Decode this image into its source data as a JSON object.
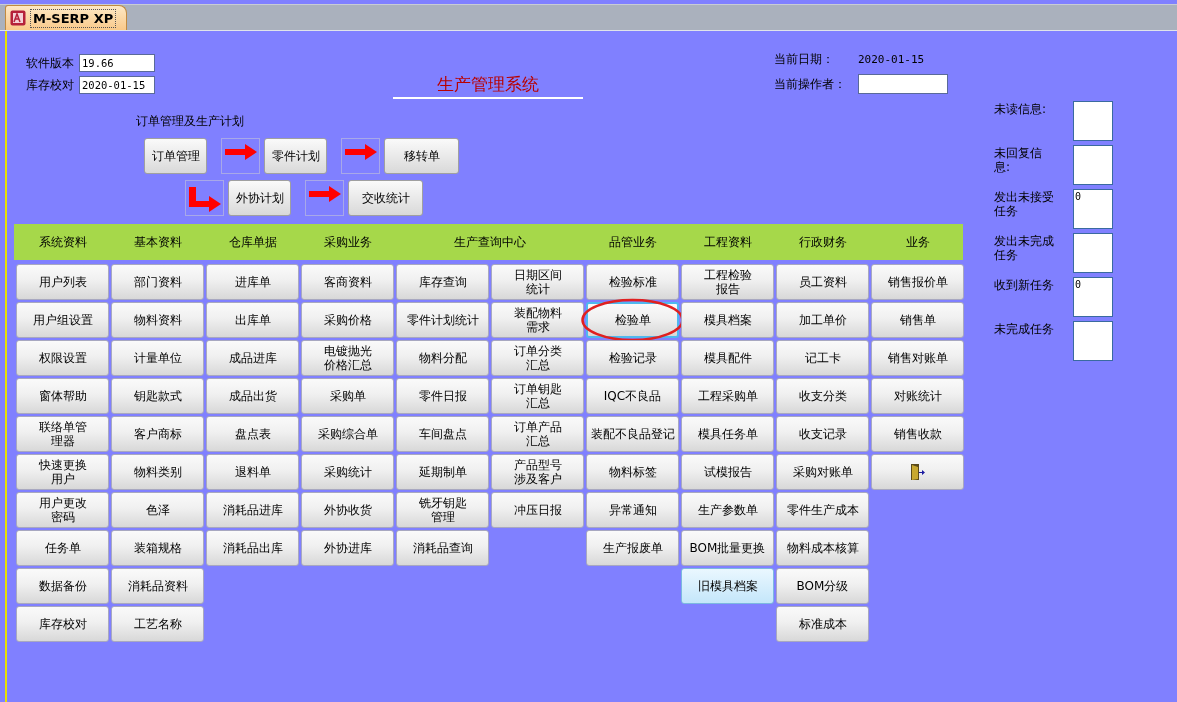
{
  "window": {
    "tab": "M-SERP XP"
  },
  "version": {
    "label": "软件版本",
    "value": "19.66"
  },
  "stock_check": {
    "label": "库存校对",
    "value": "2020-01-15"
  },
  "title": "生产管理系统",
  "current_date": {
    "label": "当前日期：",
    "value": "2020-01-15"
  },
  "operator": {
    "label": "当前操作者："
  },
  "order_plan": {
    "title": "订单管理及生产计划",
    "rows": [
      [
        {
          "kind": "button",
          "label": "订单管理"
        },
        {
          "kind": "arrow"
        },
        {
          "kind": "button",
          "label": "零件计划"
        },
        {
          "kind": "arrow"
        },
        {
          "kind": "button",
          "label": "移转单"
        }
      ],
      [
        {
          "kind": "spacer"
        },
        {
          "kind": "bend"
        },
        {
          "kind": "button",
          "label": "外协计划"
        },
        {
          "kind": "arrow"
        },
        {
          "kind": "button",
          "label": "交收统计"
        }
      ]
    ]
  },
  "menu": [
    {
      "header": "系统资料",
      "columns": [
        [
          {
            "label": "用户列表",
            "kind": "plain"
          },
          {
            "label": "用户组设置",
            "kind": "plain"
          },
          {
            "label": "权限设置",
            "kind": "plain"
          },
          {
            "label": "窗体帮助",
            "kind": "plain"
          },
          {
            "label": "联络单管理器",
            "kind": "wrapped"
          },
          {
            "label": "快速更换用户",
            "kind": "wrapped"
          },
          {
            "label": "用户更改密码",
            "kind": "wrapped"
          },
          {
            "label": "任务单",
            "kind": "plain"
          },
          {
            "label": "数据备份",
            "kind": "plain"
          },
          {
            "label": "库存校对",
            "kind": "plain"
          }
        ]
      ]
    },
    {
      "header": "基本资料",
      "columns": [
        [
          {
            "label": "部门资料",
            "kind": "plain"
          },
          {
            "label": "物料资料",
            "kind": "plain"
          },
          {
            "label": "计量单位",
            "kind": "plain"
          },
          {
            "label": "钥匙款式",
            "kind": "plain"
          },
          {
            "label": "客户商标",
            "kind": "plain"
          },
          {
            "label": "物料类别",
            "kind": "plain"
          },
          {
            "label": "色泽",
            "kind": "plain"
          },
          {
            "label": "装箱规格",
            "kind": "plain"
          },
          {
            "label": "消耗品资料",
            "kind": "plain"
          },
          {
            "label": "工艺名称",
            "kind": "plain"
          }
        ]
      ]
    },
    {
      "header": "仓库单据",
      "columns": [
        [
          {
            "label": "进库单",
            "kind": "plain"
          },
          {
            "label": "出库单",
            "kind": "plain"
          },
          {
            "label": "成品进库",
            "kind": "plain"
          },
          {
            "label": "成品出货",
            "kind": "plain"
          },
          {
            "label": "盘点表",
            "kind": "plain"
          },
          {
            "label": "退料单",
            "kind": "plain"
          },
          {
            "label": "消耗品进库",
            "kind": "plain"
          },
          {
            "label": "消耗品出库",
            "kind": "plain"
          }
        ]
      ]
    },
    {
      "header": "采购业务",
      "columns": [
        [
          {
            "label": "客商资料",
            "kind": "plain"
          },
          {
            "label": "采购价格",
            "kind": "plain"
          },
          {
            "label": "电镀抛光价格汇总",
            "kind": "wrapped"
          },
          {
            "label": "采购单",
            "kind": "plain"
          },
          {
            "label": "采购综合单",
            "kind": "plain"
          },
          {
            "label": "采购统计",
            "kind": "plain"
          },
          {
            "label": "外协收货",
            "kind": "plain"
          },
          {
            "label": "外协进库",
            "kind": "plain"
          }
        ]
      ]
    },
    {
      "header": "生产查询中心",
      "columns": [
        [
          {
            "label": "库存查询",
            "kind": "plain"
          },
          {
            "label": "零件计划统计",
            "kind": "plain"
          },
          {
            "label": "物料分配",
            "kind": "plain"
          },
          {
            "label": "零件日报",
            "kind": "plain"
          },
          {
            "label": "车间盘点",
            "kind": "plain"
          },
          {
            "label": "延期制单",
            "kind": "plain"
          },
          {
            "label": "铣牙钥匙管理",
            "kind": "wrapped"
          },
          {
            "label": "消耗品查询",
            "kind": "plain"
          }
        ],
        [
          {
            "label": "日期区间统计",
            "kind": "wrapped"
          },
          {
            "label": "装配物料需求",
            "kind": "wrapped"
          },
          {
            "label": "订单分类汇总",
            "kind": "wrapped"
          },
          {
            "label": "订单钥匙汇总",
            "kind": "wrapped"
          },
          {
            "label": "订单产品汇总",
            "kind": "wrapped"
          },
          {
            "label": "产品型号涉及客户",
            "kind": "wrapped"
          },
          {
            "label": "冲压日报",
            "kind": "plain"
          }
        ]
      ]
    },
    {
      "header": "品管业务",
      "columns": [
        [
          {
            "label": "检验标准",
            "kind": "plain"
          },
          {
            "label": "检验单",
            "kind": "circled"
          },
          {
            "label": "检验记录",
            "kind": "plain"
          },
          {
            "label": "IQC不良品",
            "kind": "plain"
          },
          {
            "label": "装配不良品登记",
            "kind": "plain"
          },
          {
            "label": "物料标签",
            "kind": "plain"
          },
          {
            "label": "异常通知",
            "kind": "plain"
          },
          {
            "label": "生产报废单",
            "kind": "plain"
          }
        ]
      ]
    },
    {
      "header": "工程资料",
      "columns": [
        [
          {
            "label": "工程检验报告",
            "kind": "wrapped"
          },
          {
            "label": "模具档案",
            "kind": "plain"
          },
          {
            "label": "模具配件",
            "kind": "plain"
          },
          {
            "label": "工程采购单",
            "kind": "plain"
          },
          {
            "label": "模具任务单",
            "kind": "plain"
          },
          {
            "label": "试模报告",
            "kind": "plain"
          },
          {
            "label": "生产参数单",
            "kind": "plain"
          },
          {
            "label": "BOM批量更换",
            "kind": "plain"
          },
          {
            "label": "旧模具档案",
            "kind": "hover"
          }
        ]
      ]
    },
    {
      "header": "行政财务",
      "columns": [
        [
          {
            "label": "员工资料",
            "kind": "plain"
          },
          {
            "label": "加工单价",
            "kind": "plain"
          },
          {
            "label": "记工卡",
            "kind": "plain"
          },
          {
            "label": "收支分类",
            "kind": "plain"
          },
          {
            "label": "收支记录",
            "kind": "plain"
          },
          {
            "label": "采购对账单",
            "kind": "plain"
          },
          {
            "label": "零件生产成本",
            "kind": "plain"
          },
          {
            "label": "物料成本核算",
            "kind": "plain"
          },
          {
            "label": "BOM分级",
            "kind": "plain"
          },
          {
            "label": "标准成本",
            "kind": "plain"
          }
        ]
      ]
    },
    {
      "header": "业务",
      "columns": [
        [
          {
            "label": "销售报价单",
            "kind": "plain"
          },
          {
            "label": "销售单",
            "kind": "plain"
          },
          {
            "label": "销售对账单",
            "kind": "plain"
          },
          {
            "label": "对账统计",
            "kind": "plain"
          },
          {
            "label": "销售收款",
            "kind": "plain"
          },
          {
            "kind": "exit"
          }
        ]
      ]
    }
  ],
  "messages": [
    {
      "label": "未读信息:"
    },
    {
      "label": "未回复信息:"
    },
    {
      "label": "发出未接受任务",
      "value": "0"
    },
    {
      "label": "发出未完成任务"
    },
    {
      "label": "收到新任务",
      "value": "0"
    },
    {
      "label": "未完成任务"
    }
  ]
}
